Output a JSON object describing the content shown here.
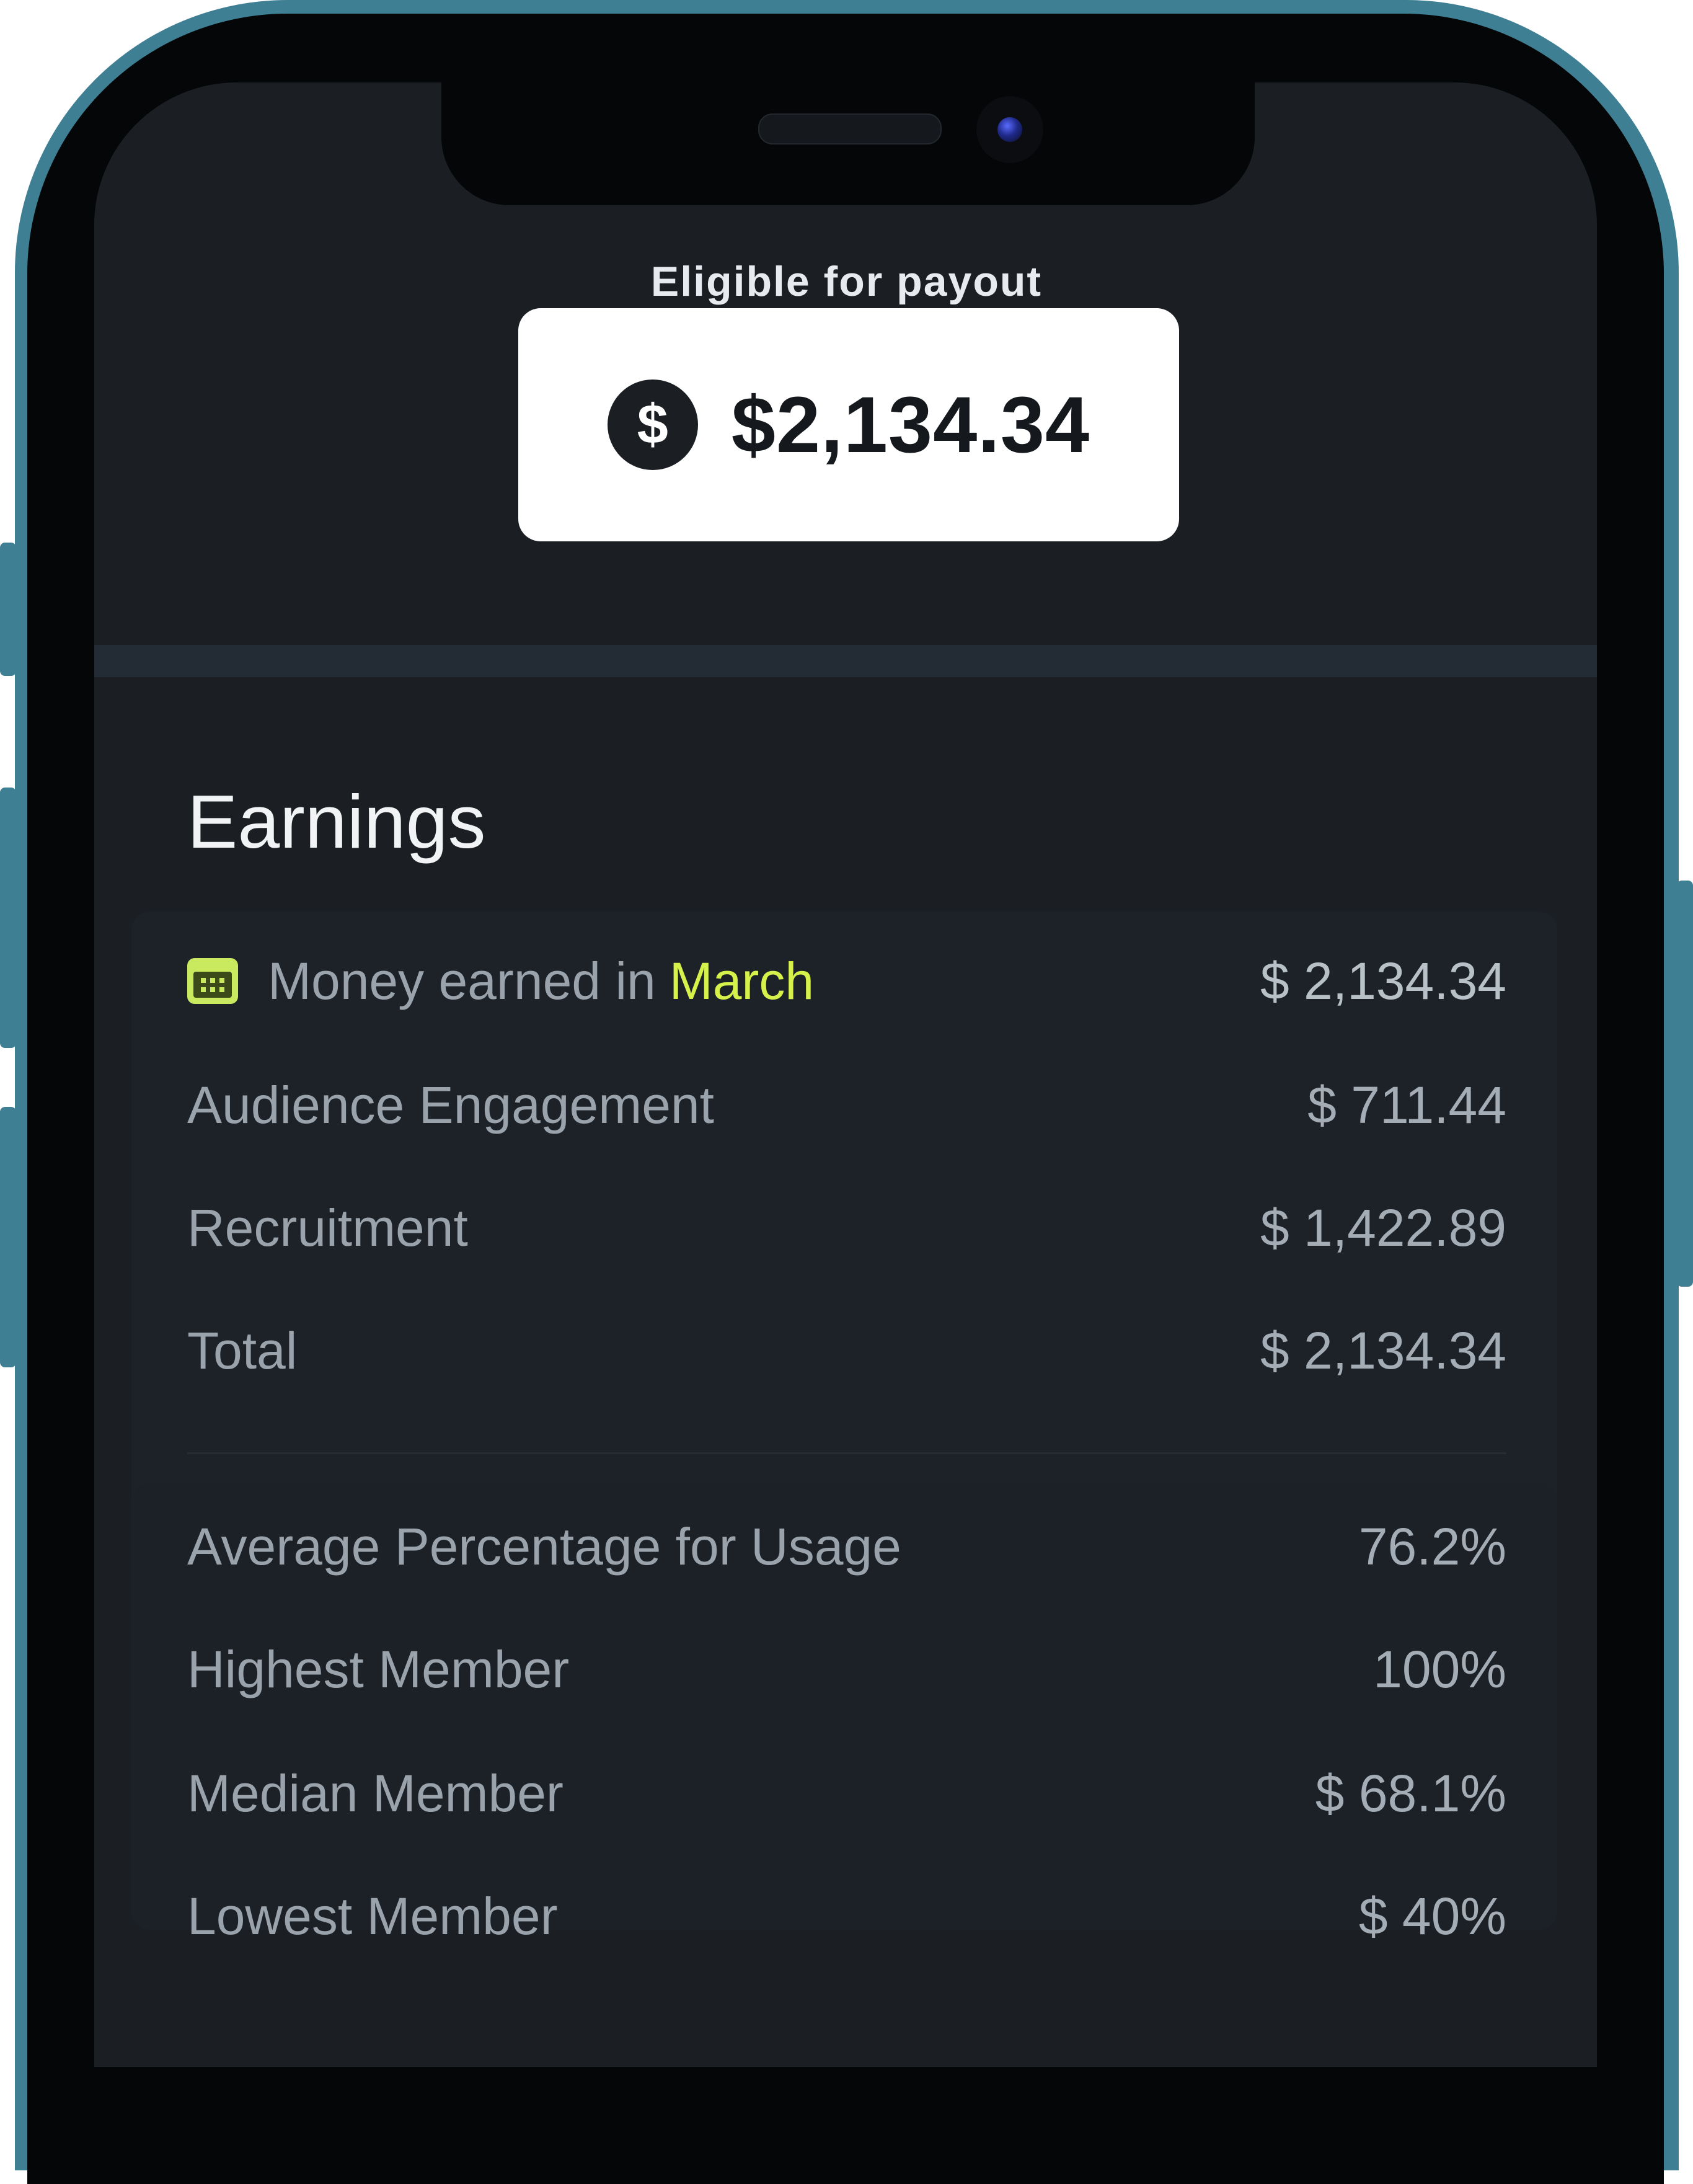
{
  "payout": {
    "label": "Eligible for payout",
    "currency_symbol": "$",
    "amount": "$2,134.34"
  },
  "earnings": {
    "title": "Earnings",
    "month_row": {
      "label_prefix": "Money earned in",
      "month": "March",
      "value": "$ 2,134.34",
      "icon": "calendar-icon"
    },
    "rows": [
      {
        "label": "Audience Engagement",
        "value": "$ 711.44"
      },
      {
        "label": "Recruitment",
        "value": "$ 1,422.89"
      },
      {
        "label": "Total",
        "value": "$ 2,134.34"
      }
    ]
  },
  "stats": {
    "rows": [
      {
        "label": "Average Percentage for Usage",
        "value": "76.2%"
      },
      {
        "label": "Highest Member",
        "value": "100%"
      },
      {
        "label": "Median Member",
        "value": "$ 68.1%"
      },
      {
        "label": "Lowest Member",
        "value": "$ 40%"
      }
    ]
  },
  "colors": {
    "background": "#1b1f24",
    "accent": "#d6f24a",
    "frame": "#3f7f94"
  }
}
